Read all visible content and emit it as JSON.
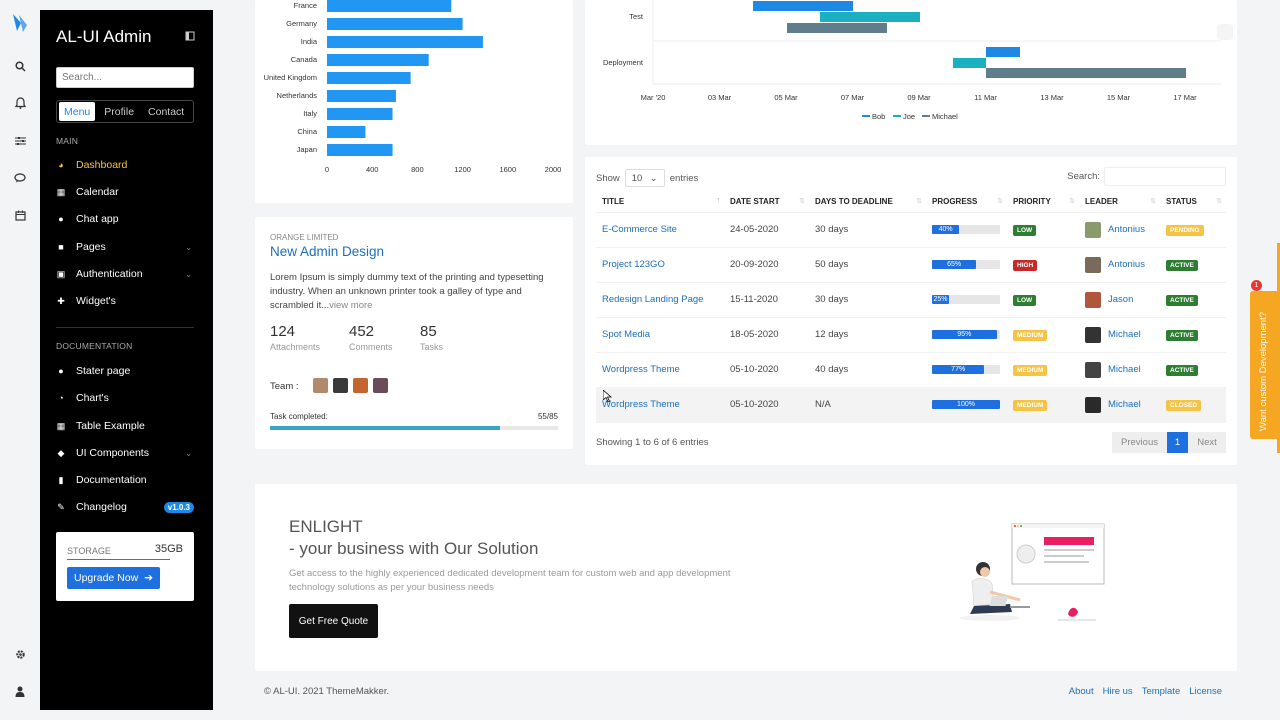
{
  "app": {
    "title": "AL-UI Admin"
  },
  "sidebar": {
    "search_placeholder": "Search...",
    "tabs": [
      "Menu",
      "Profile",
      "Contact"
    ],
    "main_label": "MAIN",
    "main_items": [
      {
        "label": "Dashboard",
        "icon": "dashboard-icon"
      },
      {
        "label": "Calendar",
        "icon": "calendar-icon"
      },
      {
        "label": "Chat app",
        "icon": "chat-icon"
      },
      {
        "label": "Pages",
        "icon": "pages-icon"
      },
      {
        "label": "Authentication",
        "icon": "lock-icon"
      },
      {
        "label": "Widget's",
        "icon": "puzzle-icon"
      }
    ],
    "doc_label": "DOCUMENTATION",
    "doc_items": [
      {
        "label": "Stater page",
        "icon": "user-icon"
      },
      {
        "label": "Chart's",
        "icon": "chart-icon"
      },
      {
        "label": "Table Example",
        "icon": "table-icon"
      },
      {
        "label": "UI Components",
        "icon": "diamond-icon"
      },
      {
        "label": "Documentation",
        "icon": "file-icon"
      },
      {
        "label": "Changelog",
        "icon": "pencil-icon",
        "badge": "v1.0.3"
      }
    ],
    "storage": {
      "label": "STORAGE",
      "value": "35GB",
      "button": "Upgrade Now"
    }
  },
  "chart_data": {
    "type": "bar",
    "orientation": "horizontal",
    "categories": [
      "France",
      "Germany",
      "India",
      "Canada",
      "United Kingdom",
      "Netherlands",
      "Italy",
      "China",
      "Japan"
    ],
    "values": [
      1100,
      1200,
      1380,
      900,
      740,
      610,
      580,
      340,
      580
    ],
    "xticks": [
      "0",
      "400",
      "800",
      "1200",
      "1600",
      "2000"
    ],
    "xlim": [
      0,
      2000
    ],
    "color": "#2196f3"
  },
  "gantt": {
    "rows": [
      "Test",
      "Deployment"
    ],
    "xticks": [
      "Mar '20",
      "03 Mar",
      "05 Mar",
      "07 Mar",
      "09 Mar",
      "11 Mar",
      "13 Mar",
      "15 Mar",
      "17 Mar"
    ],
    "legend": [
      {
        "name": "Bob",
        "color": "#1e88e5"
      },
      {
        "name": "Joe",
        "color": "#1ab0c2"
      },
      {
        "name": "Michael",
        "color": "#607d8b"
      }
    ]
  },
  "project": {
    "company": "ORANGE LIMITED",
    "title": "New Admin Design",
    "description": "Lorem Ipsum is simply dummy text of the printing and typesetting industry. When an unknown printer took a galley of type and scrambled it...",
    "view_more": "view more",
    "stats": [
      {
        "value": "124",
        "label": "Attachments"
      },
      {
        "value": "452",
        "label": "Comments"
      },
      {
        "value": "85",
        "label": "Tasks"
      }
    ],
    "team_label": "Team :",
    "task_label": "Task completed:",
    "task_value": "55/85",
    "task_progress": 0.8
  },
  "table": {
    "show": "Show",
    "entries_value": "10",
    "entries": "entries",
    "search_label": "Search:",
    "headers": [
      "TITLE",
      "DATE START",
      "DAYS TO DEADLINE",
      "PROGRESS",
      "PRIORITY",
      "LEADER",
      "STATUS"
    ],
    "rows": [
      {
        "title": "E-Commerce Site",
        "date": "24-05-2020",
        "days": "30 days",
        "progress": "40%",
        "pct": 40,
        "priority": "LOW",
        "pcolor": "#2e7d32",
        "leader": "Antonius",
        "status": "PENDING",
        "scolor": "#f6c343"
      },
      {
        "title": "Project 123GO",
        "date": "20-09-2020",
        "days": "50 days",
        "progress": "65%",
        "pct": 65,
        "priority": "HIGH",
        "pcolor": "#c62828",
        "leader": "Antonius",
        "status": "ACTIVE",
        "scolor": "#2e7d32"
      },
      {
        "title": "Redesign Landing Page",
        "date": "15-11-2020",
        "days": "30 days",
        "progress": "25%",
        "pct": 25,
        "priority": "LOW",
        "pcolor": "#2e7d32",
        "leader": "Jason",
        "status": "ACTIVE",
        "scolor": "#2e7d32"
      },
      {
        "title": "Spot Media",
        "date": "18-05-2020",
        "days": "12 days",
        "progress": "95%",
        "pct": 95,
        "priority": "MEDIUM",
        "pcolor": "#f6c343",
        "leader": "Michael",
        "status": "ACTIVE",
        "scolor": "#2e7d32"
      },
      {
        "title": "Wordpress Theme",
        "date": "05-10-2020",
        "days": "40 days",
        "progress": "77%",
        "pct": 77,
        "priority": "MEDIUM",
        "pcolor": "#f6c343",
        "leader": "Michael",
        "status": "ACTIVE",
        "scolor": "#2e7d32"
      },
      {
        "title": "Wordpress Theme",
        "date": "05-10-2020",
        "days": "N/A",
        "progress": "100%",
        "pct": 100,
        "priority": "MEDIUM",
        "pcolor": "#f6c343",
        "leader": "Michael",
        "status": "CLOSED",
        "scolor": "#f6c343"
      }
    ],
    "info": "Showing 1 to 6 of 6 entries",
    "prev": "Previous",
    "page": "1",
    "next": "Next"
  },
  "cta": {
    "title1": "ENLIGHT",
    "title2": "- your business with Our Solution",
    "text": "Get access to the highly experienced dedicated development team for custom web and app development technology solutions as per your business needs",
    "button": "Get Free Quote"
  },
  "footer": {
    "copyright": "© AL-UI. 2021 ThemeMakker.",
    "links": [
      "About",
      "Hire us",
      "Template",
      "License"
    ]
  },
  "side_tab": {
    "text": "Want custom Development?",
    "badge": "1"
  }
}
